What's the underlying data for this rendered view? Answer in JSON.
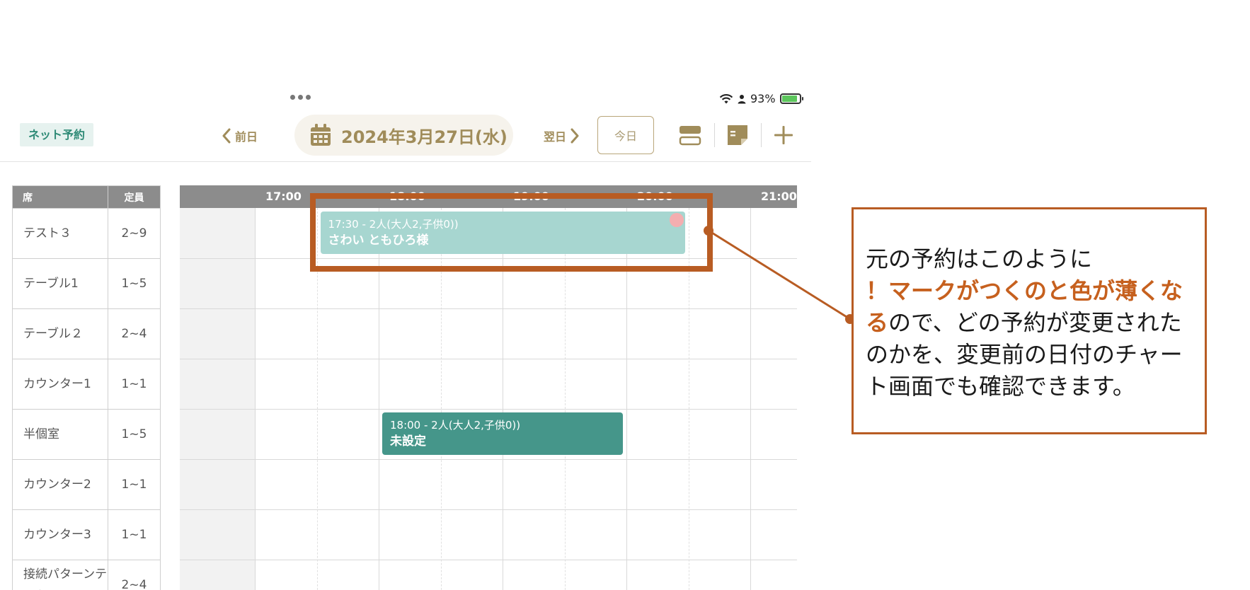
{
  "status_bar": {
    "battery": "93%"
  },
  "toolbar": {
    "net_reservation_label": "ネット予約",
    "prev_label": "前日",
    "date_label": "2024年3月27日(水)",
    "next_label": "翌日",
    "today_label": "今日",
    "icons": [
      "calendar-icon",
      "layout-toggle-icon",
      "memo-icon",
      "add-icon"
    ],
    "accent_color": "#a08c5a"
  },
  "seat_table": {
    "headers": {
      "seat": "席",
      "capacity": "定員"
    },
    "rows": [
      {
        "name": "テスト３",
        "capacity": "2~9"
      },
      {
        "name": "テーブル1",
        "capacity": "1~5"
      },
      {
        "name": "テーブル２",
        "capacity": "2~4"
      },
      {
        "name": "カウンター1",
        "capacity": "1~1"
      },
      {
        "name": "半個室",
        "capacity": "1~5"
      },
      {
        "name": "カウンター2",
        "capacity": "1~1"
      },
      {
        "name": "カウンター3",
        "capacity": "1~1"
      },
      {
        "name": "接続パターンテスト",
        "capacity": "2~4"
      }
    ]
  },
  "timeline": {
    "hours": [
      "17:00",
      "18:00",
      "19:00",
      "20:00",
      "21:00"
    ],
    "reservations": [
      {
        "row": 0,
        "start": "17:30",
        "end": "20:30",
        "detail": "17:30 - 2人(大人2,子供0))",
        "name": "さわい ともひろ様",
        "style": "faded",
        "alert": true,
        "color": "#a7d6d0"
      },
      {
        "row": 4,
        "start": "18:00",
        "end": "20:00",
        "detail": "18:00 - 2人(大人2,子供0))",
        "name": "未設定",
        "style": "solid",
        "alert": false,
        "color": "#45968a"
      }
    ]
  },
  "callout": {
    "line1": "元の予約はこのように",
    "highlight": "！マークがつくのと色が薄くなる",
    "rest": "ので、どの予約が変更されたのかを、変更前の日付のチャート画面でも確認できます。",
    "border_color": "#b85c23",
    "highlight_color": "#c6601e"
  }
}
